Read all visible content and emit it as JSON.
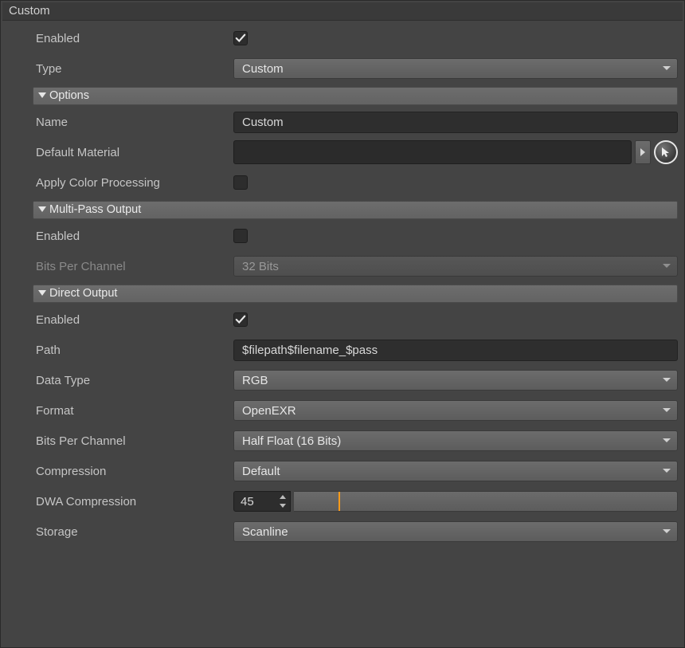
{
  "panel": {
    "title": "Custom",
    "enabled_label": "Enabled",
    "enabled_value": true,
    "type_label": "Type",
    "type_value": "Custom"
  },
  "options": {
    "header": "Options",
    "name_label": "Name",
    "name_value": "Custom",
    "default_material_label": "Default Material",
    "default_material_value": "",
    "apply_color_label": "Apply Color Processing",
    "apply_color_value": false
  },
  "multipass": {
    "header": "Multi-Pass Output",
    "enabled_label": "Enabled",
    "enabled_value": false,
    "bits_label": "Bits Per Channel",
    "bits_value": "32 Bits"
  },
  "direct": {
    "header": "Direct Output",
    "enabled_label": "Enabled",
    "enabled_value": true,
    "path_label": "Path",
    "path_value": "$filepath$filename_$pass",
    "datatype_label": "Data Type",
    "datatype_value": "RGB",
    "format_label": "Format",
    "format_value": "OpenEXR",
    "bits_label": "Bits Per Channel",
    "bits_value": "Half Float (16 Bits)",
    "compression_label": "Compression",
    "compression_value": "Default",
    "dwa_label": "DWA Compression",
    "dwa_value": "45",
    "dwa_fill_percent": 12,
    "storage_label": "Storage",
    "storage_value": "Scanline"
  }
}
